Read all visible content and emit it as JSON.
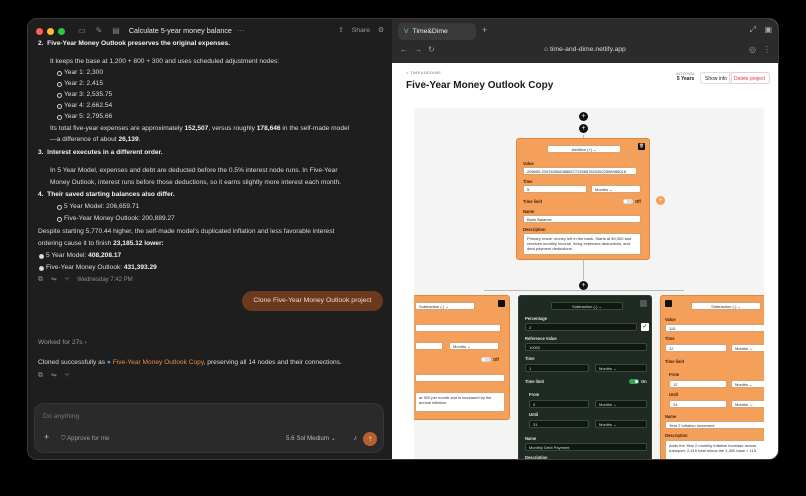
{
  "window": {
    "title": "Calculate 5-year money balance",
    "share": "Share"
  },
  "chat": {
    "point2": {
      "num": "2.",
      "title": "Five-Year Money Outlook preserves the original expenses."
    },
    "p2_text": "It keeps the base at 1,200 + 800 + 300 and uses scheduled adjustment nodes:",
    "years": [
      "Year 1: 2,300",
      "Year 2: 2,415",
      "Year 3: 2,535.75",
      "Year 4: 2,662.54",
      "Year 5: 2,795.66"
    ],
    "total_pre": "Its total five-year expenses are approximately ",
    "total_val": "152,507",
    "total_mid": ", versus roughly ",
    "total_val2": "178,646",
    "total_post": " in the self-made model",
    "diff_pre": "—a difference of about ",
    "diff_val": "26,139",
    "diff_post": ".",
    "point3": {
      "num": "3.",
      "title": "Interest executes in a different order."
    },
    "p3_line1": "In 5 Year Model, expenses and debt are deducted before the 0.5% interest node runs. In Five-Year",
    "p3_line2": "Money Outlook, interest runs before those deductions, so it earns slightly more interest each month.",
    "point4": {
      "num": "4.",
      "title": "Their saved starting balances also differ."
    },
    "start1": "5 Year Model: 206,659.71",
    "start2": "Five-Year Money Outlook: 200,889.27",
    "desp_line1": "Despite starting 5,770.44 higher, the self-made model's duplicated inflation and less favorable interest",
    "desp_line2_pre": "ordering cause it to finish ",
    "desp_line2_val": "23,185.12 lower",
    "final1_pre": "5 Year Model: ",
    "final1_val": "408,208.17",
    "final2_pre": "Five-Year Money Outlook: ",
    "final2_val": "431,393.29",
    "time": "Wednesday 7:42 PM",
    "clone_button": "Clone Five-Year Money Outlook project",
    "worked": "Worked for 27s",
    "cloned_pre": "Cloned successfully as ",
    "cloned_link": "Five-Year Money Outlook Copy",
    "cloned_post": ", preserving all 14 nodes and their connections.",
    "input_placeholder": "Do anything",
    "approve": "Approve for me",
    "model": "5.6 Sol",
    "effort": "Medium"
  },
  "browser": {
    "tab": "Time&Dime",
    "url": "time-and-dime.netlify.app"
  },
  "app": {
    "crumb": "< TIMEANDDIME",
    "title": "Five-Year Money Outlook Copy",
    "interval_label": "INTERVAL",
    "interval": "5 Years",
    "show_info": "Show info",
    "delete": "Delete project"
  },
  "nodes": {
    "top": {
      "op": "Addition (+)",
      "value_label": "Value",
      "value": "206659.20078280838865771356678202622588988018",
      "time_label": "Time",
      "time": "5",
      "unit": "Months",
      "limit_label": "Time limit",
      "limit_state": "Off",
      "name_label": "Name",
      "name": "Bank Balance",
      "desc_label": "Description",
      "desc": "Primary result: money left in the bank. Starts at 50,000 and receives monthly income, living expenses deductions, and debt payment deductions."
    },
    "left": {
      "op": "Subtraction (-)",
      "unit": "Months",
      "limit_state": "Off",
      "desc": "at 300 per month and is increased by the annual inflation."
    },
    "mid": {
      "op": "Subtraction (-)",
      "pct_label": "Percentage",
      "pct": "2",
      "ref_label": "Reference Value",
      "ref": "10000",
      "time_label": "Time",
      "time": "1",
      "unit": "Months",
      "limit_label": "Time limit",
      "limit_state": "On",
      "from_label": "From",
      "from": "0",
      "until_label": "Until",
      "until": "31",
      "name_label": "Name",
      "name": "Monthly Debt Payment",
      "desc_label": "Description"
    },
    "right": {
      "op": "Subtraction (-)",
      "value_label": "Value",
      "value": "115",
      "time_label": "Time",
      "time": "12",
      "unit": "Months",
      "limit_label": "Time limit",
      "from_label": "From",
      "from": "12",
      "until_label": "Until",
      "until": "24",
      "name_label": "Name",
      "name": "Year 2 Inflation Increment",
      "desc_label": "Description",
      "desc": "Adds the Year 2 monthly inflation increase across transport: 2,415 total minus the 2,300 base = 115."
    }
  },
  "colors": {
    "accent": "#f5a05a",
    "clone_bg": "#6b3a1e",
    "link": "#e8894a"
  }
}
